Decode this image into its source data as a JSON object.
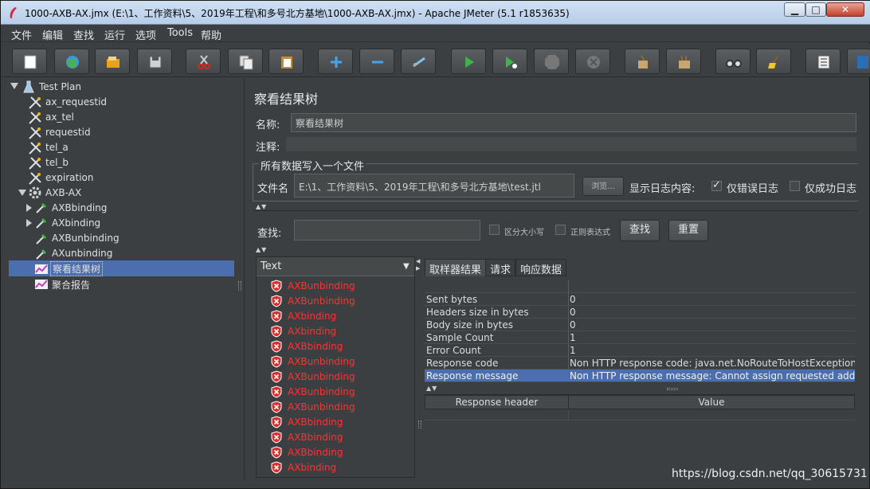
{
  "window": {
    "title": "1000-AXB-AX.jmx (E:\\1、工作资料\\5、2019年工程\\和多号北方基地\\1000-AXB-AX.jmx) - Apache JMeter (5.1 r1853635)",
    "controls": {
      "minimize": "▁",
      "maximize": "□",
      "close": "✕"
    }
  },
  "menu": [
    "文件",
    "编辑",
    "查找",
    "运行",
    "选项",
    "Tools",
    "帮助"
  ],
  "toolbar_icons": [
    "new-icon",
    "templates-icon",
    "open-icon",
    "save-icon",
    "cut-icon",
    "copy-icon",
    "paste-icon",
    "expand-icon",
    "collapse-icon",
    "toggle-icon",
    "start-icon",
    "start-no-pause-icon",
    "stop-icon",
    "shutdown-icon",
    "clear-icon",
    "clear-all-icon",
    "search-icon",
    "reset-search-icon",
    "function-helper-icon",
    "help-icon"
  ],
  "tree": [
    {
      "label": "Test Plan",
      "icon": "flask-icon",
      "level": 0,
      "expanded": true
    },
    {
      "label": "ax_requestid",
      "icon": "tool-icon",
      "level": 1
    },
    {
      "label": "ax_tel",
      "icon": "tool-icon",
      "level": 1
    },
    {
      "label": "requestid",
      "icon": "tool-icon",
      "level": 1
    },
    {
      "label": "tel_a",
      "icon": "tool-icon",
      "level": 1
    },
    {
      "label": "tel_b",
      "icon": "tool-icon",
      "level": 1
    },
    {
      "label": "expiration",
      "icon": "tool-icon",
      "level": 1
    },
    {
      "label": "AXB-AX",
      "icon": "gear-icon",
      "level": 1,
      "expanded": true
    },
    {
      "label": "AXBbinding",
      "icon": "sampler-icon",
      "level": 2,
      "collapsed": true
    },
    {
      "label": "AXbinding",
      "icon": "sampler-icon",
      "level": 2,
      "collapsed": true
    },
    {
      "label": "AXBunbinding",
      "icon": "sampler-icon",
      "level": 2
    },
    {
      "label": "AXunbinding",
      "icon": "sampler-icon",
      "level": 2
    },
    {
      "label": "察看结果树",
      "icon": "listener-icon",
      "level": 1,
      "selected": true
    },
    {
      "label": "聚合报告",
      "icon": "listener-icon",
      "level": 1
    }
  ],
  "panel": {
    "title": "察看结果树",
    "name_label": "名称:",
    "name_value": "察看结果树",
    "comment_label": "注释:",
    "comment_value": "",
    "file_group_title": "所有数据写入一个文件",
    "filename_label": "文件名",
    "filename_value": "E:\\1、工作资料\\5、2019年工程\\和多号北方基地\\test.jtl",
    "browse_button": "浏览...",
    "log_label": "显示日志内容:",
    "errors_only_label": "仅错误日志",
    "errors_only_checked": true,
    "success_only_label": "仅成功日志",
    "success_only_checked": false,
    "search_label": "查找:",
    "search_value": "",
    "case_sensitive_label": "区分大小写",
    "regex_label": "正则表达式",
    "search_button": "查找",
    "reset_button": "重置"
  },
  "result_list": {
    "renderer": "Text",
    "items": [
      "AXBunbinding",
      "AXBunbinding",
      "AXbinding",
      "AXbinding",
      "AXBbinding",
      "AXBunbinding",
      "AXBunbinding",
      "AXBunbinding",
      "AXBunbinding",
      "AXBbinding",
      "AXBbinding",
      "AXBbinding",
      "AXbinding"
    ]
  },
  "tabs": [
    "取样器结果",
    "请求",
    "响应数据"
  ],
  "sampler_result": [
    {
      "key": "",
      "value": ""
    },
    {
      "key": "Sent bytes",
      "value": "0"
    },
    {
      "key": "Headers size in bytes",
      "value": "0"
    },
    {
      "key": "Body size in bytes",
      "value": "0"
    },
    {
      "key": "Sample Count",
      "value": "1"
    },
    {
      "key": "Error Count",
      "value": "1"
    },
    {
      "key": "Response code",
      "value": "Non HTTP response code: java.net.NoRouteToHostException"
    },
    {
      "key": "Response message",
      "value": "Non HTTP response message: Cannot assign requested address"
    }
  ],
  "header_table": {
    "col1": "Response header",
    "col2": "Value"
  },
  "watermark": "https://blog.csdn.net/qq_30615731"
}
